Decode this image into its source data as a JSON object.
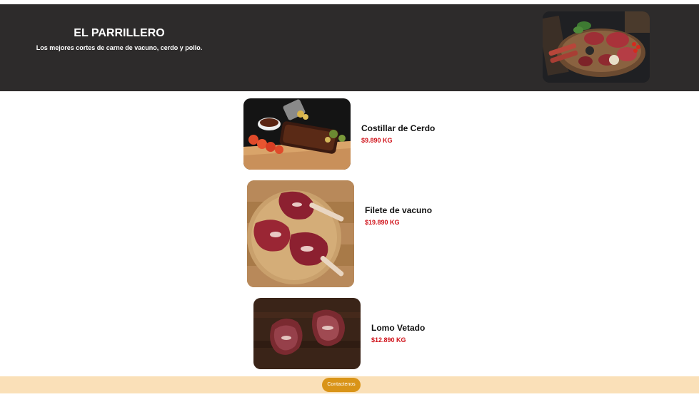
{
  "header": {
    "title": "EL PARRILLERO",
    "subtitle": "Los mejores cortes de carne de vacuno, cerdo y pollo."
  },
  "products": [
    {
      "name": "Costillar de Cerdo",
      "price": "$9.890 KG",
      "image": "ribs-platter-image"
    },
    {
      "name": "Filete de vacuno",
      "price": "$19.890 KG",
      "image": "beef-steaks-board-image"
    },
    {
      "name": "Lomo Vetado",
      "price": "$12.890 KG",
      "image": "ribeye-steaks-image"
    }
  ],
  "footer": {
    "contact_label": "Contactenos"
  },
  "colors": {
    "header_bg": "#2d2b2b",
    "price": "#d0121a",
    "footer_bg": "#fae0b8",
    "button": "#d99418"
  }
}
